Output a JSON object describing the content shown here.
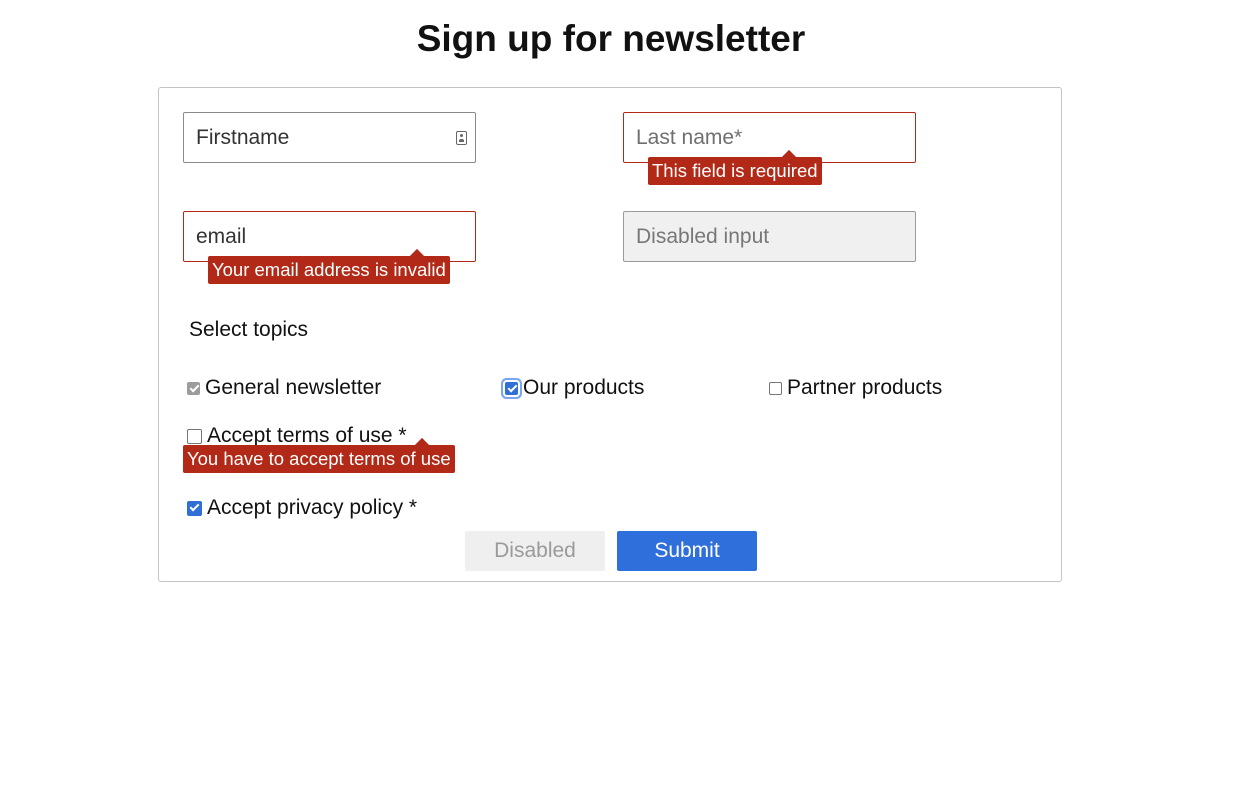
{
  "page": {
    "title": "Sign up for newsletter"
  },
  "form": {
    "firstname": {
      "placeholder": "Firstname",
      "value": "Firstname"
    },
    "lastname": {
      "placeholder": "Last name*",
      "error": "This field is required"
    },
    "email": {
      "placeholder": "email",
      "value": "email",
      "error": "Your email address is invalid"
    },
    "disabled_input": {
      "placeholder": "Disabled input"
    },
    "topics": {
      "label": "Select topics",
      "items": [
        {
          "label": "General newsletter",
          "checked": true,
          "disabled": true
        },
        {
          "label": "Our products",
          "checked": true,
          "focused": true
        },
        {
          "label": "Partner products",
          "checked": false
        }
      ]
    },
    "terms": {
      "label": "Accept terms of use *",
      "checked": false,
      "error": "You have to accept terms of use"
    },
    "privacy": {
      "label": "Accept privacy policy *",
      "checked": true
    },
    "buttons": {
      "disabled_label": "Disabled",
      "submit_label": "Submit"
    }
  },
  "colors": {
    "error": "#b22a17",
    "primary": "#2f6fdb",
    "disabled_bg": "#efefef"
  },
  "icons": {
    "firstname_field": "contact-card-icon"
  }
}
